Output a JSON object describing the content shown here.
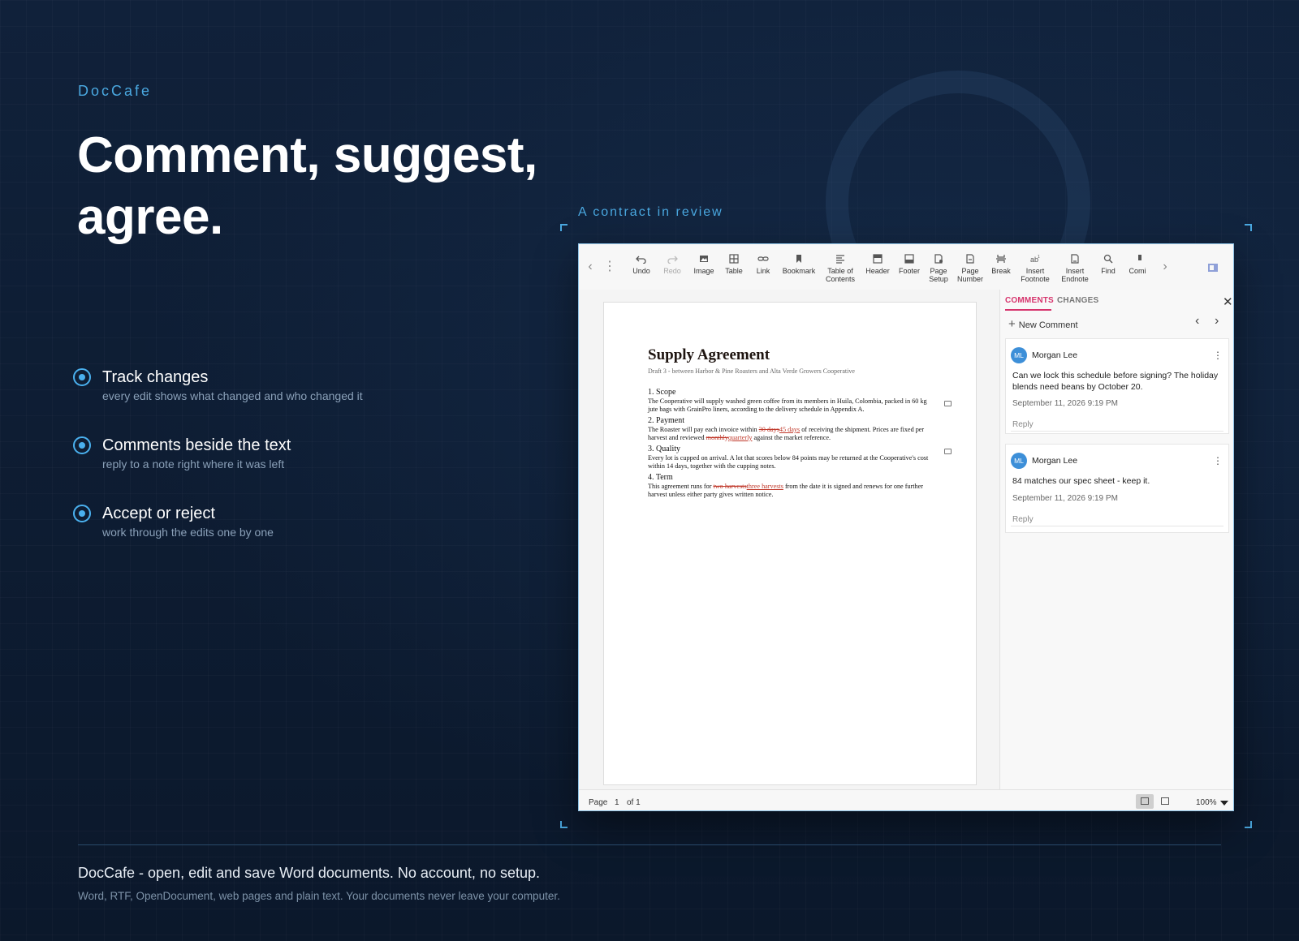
{
  "brand": "DocCafe",
  "headline": "Comment, suggest, agree.",
  "features": [
    {
      "title": "Track changes",
      "sub": "every edit shows what changed and who changed it"
    },
    {
      "title": "Comments beside the text",
      "sub": "reply to a note right where it was left"
    },
    {
      "title": "Accept or reject",
      "sub": "work through the edits one by one"
    }
  ],
  "caption": "A contract in review",
  "toolbar": {
    "buttons": [
      {
        "label": "Undo",
        "icon": "undo-icon"
      },
      {
        "label": "Redo",
        "icon": "redo-icon"
      },
      {
        "label": "Image",
        "icon": "image-icon"
      },
      {
        "label": "Table",
        "icon": "table-icon"
      },
      {
        "label": "Link",
        "icon": "link-icon"
      },
      {
        "label": "Bookmark",
        "icon": "bookmark-icon"
      },
      {
        "label": "Table of Contents",
        "icon": "toc-icon"
      },
      {
        "label": "Header",
        "icon": "header-icon"
      },
      {
        "label": "Footer",
        "icon": "footer-icon"
      },
      {
        "label": "Page Setup",
        "icon": "page-setup-icon"
      },
      {
        "label": "Page Number",
        "icon": "page-number-icon"
      },
      {
        "label": "Break",
        "icon": "break-icon"
      },
      {
        "label": "Insert Footnote",
        "icon": "footnote-icon"
      },
      {
        "label": "Insert Endnote",
        "icon": "endnote-icon"
      },
      {
        "label": "Find",
        "icon": "search-icon"
      },
      {
        "label": "Comi",
        "icon": "comment-icon"
      }
    ]
  },
  "document": {
    "title": "Supply Agreement",
    "subtitle": "Draft 3 - between Harbor & Pine Roasters and Alta Verde Growers Cooperative",
    "sections": {
      "scope": {
        "heading": "1. Scope",
        "text": "The Cooperative will supply washed green coffee from its members in Huila, Colombia, packed in 60 kg jute bags with GrainPro liners, according to the delivery schedule in Appendix A."
      },
      "payment": {
        "heading": "2. Payment",
        "t1": "The Roaster will pay each invoice within ",
        "del1": "30 days",
        "ins1": "45 days",
        "t2": " of receiving the shipment. Prices are fixed per harvest and reviewed ",
        "del2": "monthly",
        "ins2": "quarterly",
        "t3": " against the market reference."
      },
      "quality": {
        "heading": "3. Quality",
        "text": "Every lot is cupped on arrival. A lot that scores below 84 points may be returned at the Cooperative's cost within 14 days, together with the cupping notes."
      },
      "term": {
        "heading": "4. Term",
        "t1": "This agreement runs for ",
        "del1": "two harvests",
        "ins1": "three harvests",
        "t2": " from the date it is signed and renews for one further harvest unless either party gives written notice."
      }
    }
  },
  "sidepanel": {
    "tab_comments": "COMMENTS",
    "tab_changes": "CHANGES",
    "new_comment": "New Comment",
    "comments": [
      {
        "initials": "ML",
        "author": "Morgan Lee",
        "text": "Can we lock this schedule before signing? The holiday blends need beans by October 20.",
        "date": "September 11, 2026 9:19 PM",
        "reply": "Reply"
      },
      {
        "initials": "ML",
        "author": "Morgan Lee",
        "text": "84 matches our spec sheet - keep it.",
        "date": "September 11, 2026 9:19 PM",
        "reply": "Reply"
      }
    ]
  },
  "status": {
    "page_label": "Page",
    "page_num": "1",
    "of_label": "of 1",
    "zoom": "100%"
  },
  "footer": {
    "title": "DocCafe - open, edit and save Word documents. No account, no setup.",
    "sub": "Word, RTF, OpenDocument, web pages and plain text. Your documents never leave your computer."
  },
  "colors": {
    "accent": "#4aa8e0",
    "track_change": "#c0392b",
    "tab_active": "#d6336c",
    "background": "#0f1e33"
  }
}
